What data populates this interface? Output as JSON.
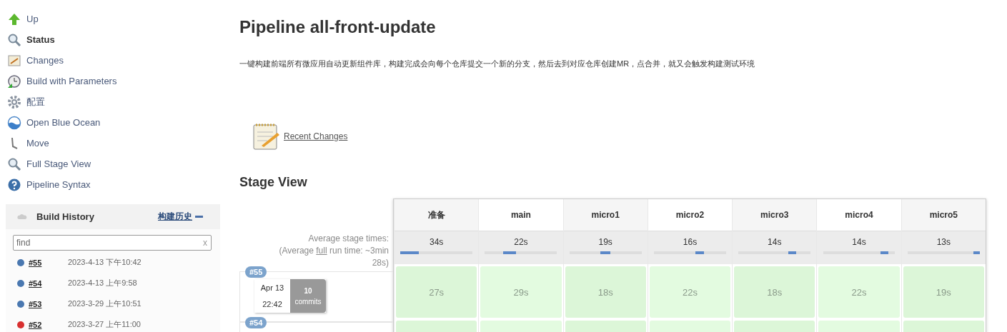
{
  "sidebar": {
    "items": [
      {
        "label": "Up",
        "selected": false
      },
      {
        "label": "Status",
        "selected": true
      },
      {
        "label": "Changes",
        "selected": false
      },
      {
        "label": "Build with Parameters",
        "selected": false
      },
      {
        "label": "配置",
        "selected": false
      },
      {
        "label": "Open Blue Ocean",
        "selected": false
      },
      {
        "label": "Move",
        "selected": false
      },
      {
        "label": "Full Stage View",
        "selected": false
      },
      {
        "label": "Pipeline Syntax",
        "selected": false
      }
    ]
  },
  "build_history": {
    "title": "Build History",
    "link": "构建历史",
    "search": {
      "placeholder": "find",
      "clear": "x"
    },
    "builds": [
      {
        "number": "#55",
        "time": "2023-4-13 下午10:42",
        "color": "#4a78b0"
      },
      {
        "number": "#54",
        "time": "2023-4-13 上午9:58",
        "color": "#4a78b0"
      },
      {
        "number": "#53",
        "time": "2023-3-29 上午10:51",
        "color": "#4a78b0"
      },
      {
        "number": "#52",
        "time": "2023-3-27 上午11:00",
        "color": "#d83030"
      }
    ]
  },
  "title": "Pipeline all-front-update",
  "description": "一键构建前端所有微应用自动更新组件库，构建完成会向每个仓库提交一个新的分支，然后去到对应仓库创建MR，点合并，就又会触发构建测试环境",
  "recent_changes": "Recent Changes",
  "stage_view": {
    "title": "Stage View",
    "average_label": "Average stage times:",
    "average_full": "(Average **full** run time: ~3min 28s)",
    "stages": [
      {
        "name": "准备",
        "average": "34s"
      },
      {
        "name": "main",
        "average": "22s"
      },
      {
        "name": "micro1",
        "average": "19s"
      },
      {
        "name": "micro2",
        "average": "16s"
      },
      {
        "name": "micro3",
        "average": "14s"
      },
      {
        "name": "micro4",
        "average": "14s"
      },
      {
        "name": "micro5",
        "average": "13s"
      }
    ],
    "runs": [
      {
        "number": "#55",
        "date": "Apr 13",
        "time": "22:42",
        "commits_count": "10",
        "commits_label": "commits",
        "durations": [
          "27s",
          "29s",
          "18s",
          "22s",
          "18s",
          "22s",
          "19s"
        ]
      },
      {
        "number": "#54"
      }
    ]
  }
}
